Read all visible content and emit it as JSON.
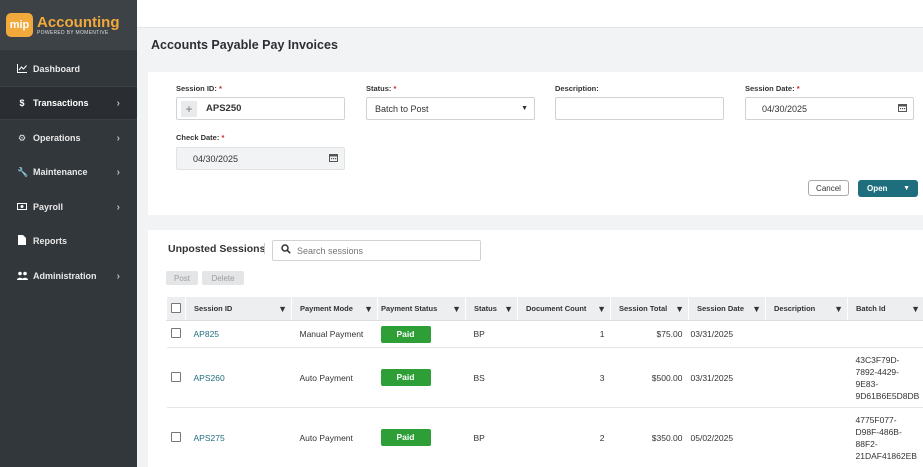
{
  "logo": {
    "badge": "mip",
    "title": "Accounting",
    "subtitle": "POWERED BY MOMENTIVE"
  },
  "sidebar": {
    "items": [
      {
        "label": "Dashboard",
        "icon": "chart-line-icon",
        "chevron": false
      },
      {
        "label": "Transactions",
        "icon": "dollar-icon",
        "chevron": true
      },
      {
        "label": "Operations",
        "icon": "gears-icon",
        "chevron": true
      },
      {
        "label": "Maintenance",
        "icon": "wrench-icon",
        "chevron": true
      },
      {
        "label": "Payroll",
        "icon": "money-bill-icon",
        "chevron": true
      },
      {
        "label": "Reports",
        "icon": "file-icon",
        "chevron": false
      },
      {
        "label": "Administration",
        "icon": "users-icon",
        "chevron": true
      }
    ]
  },
  "page": {
    "title": "Accounts Payable Pay Invoices"
  },
  "form": {
    "session_id_label": "Session ID:",
    "session_id_value": "APS250",
    "status_label": "Status:",
    "status_value": "Batch to Post",
    "description_label": "Description:",
    "description_value": "",
    "session_date_label": "Session Date:",
    "session_date_value": "04/30/2025",
    "check_date_label": "Check Date:",
    "check_date_value": "04/30/2025",
    "required_mark": "*",
    "cancel_label": "Cancel",
    "open_label": "Open"
  },
  "sessions": {
    "title": "Unposted Sessions",
    "search_placeholder": "Search sessions",
    "post_label": "Post",
    "delete_label": "Delete",
    "columns": [
      "Session ID",
      "Payment Mode",
      "Payment Status",
      "Status",
      "Document Count",
      "Session Total",
      "Session Date",
      "Description",
      "Batch Id"
    ],
    "rows": [
      {
        "session_id": "AP825",
        "payment_mode": "Manual Payment",
        "payment_status": "Paid",
        "status": "BP",
        "document_count": "1",
        "session_total": "$75.00",
        "session_date": "03/31/2025",
        "description": "",
        "batch_id": ""
      },
      {
        "session_id": "APS260",
        "payment_mode": "Auto Payment",
        "payment_status": "Paid",
        "status": "BS",
        "document_count": "3",
        "session_total": "$500.00",
        "session_date": "03/31/2025",
        "description": "",
        "batch_id_lines": [
          "43C3F79D-",
          "7892-4429-",
          "9E83-",
          "9D61B6E5D8DB"
        ]
      },
      {
        "session_id": "APS275",
        "payment_mode": "Auto Payment",
        "payment_status": "Paid",
        "status": "BP",
        "document_count": "2",
        "session_total": "$350.00",
        "session_date": "05/02/2025",
        "description": "",
        "batch_id_lines": [
          "4775F077-",
          "D98F-486B-",
          "88F2-",
          "21DAF41862EB"
        ]
      }
    ]
  },
  "colors": {
    "sidebar": "#32373c",
    "accent": "#1f6e7e",
    "logo": "#f2a93b",
    "paid": "#2e9e36",
    "required": "#c62828"
  }
}
